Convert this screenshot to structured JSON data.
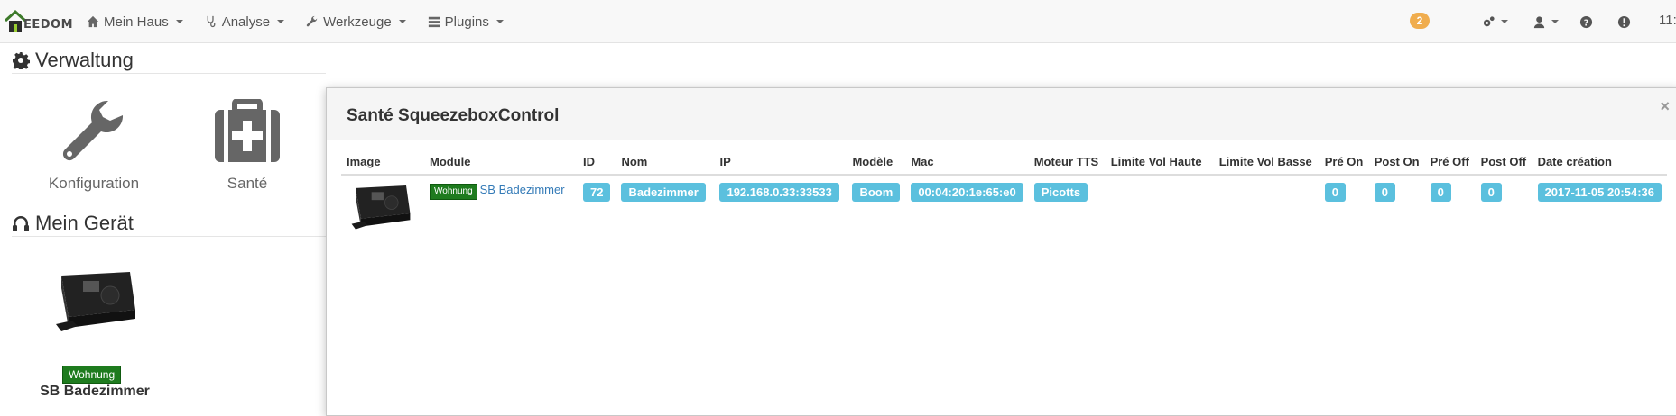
{
  "navbar": {
    "brand": "EEDOM",
    "menu": [
      {
        "label": "Mein Haus",
        "icon": "home-icon"
      },
      {
        "label": "Analyse",
        "icon": "stethoscope-icon"
      },
      {
        "label": "Werkzeuge",
        "icon": "wrench-icon"
      },
      {
        "label": "Plugins",
        "icon": "tasks-icon"
      }
    ],
    "notification_count": "2",
    "clock": "11:"
  },
  "left": {
    "verwaltung_title": "Verwaltung",
    "tiles": [
      {
        "label": "Konfiguration",
        "icon": "wrench-icon"
      },
      {
        "label": "Santé",
        "icon": "medkit-icon"
      }
    ],
    "geraet_title": "Mein Gerät",
    "device": {
      "room_badge": "Wohnung",
      "name": "SB Badezimmer"
    }
  },
  "modal": {
    "title": "Santé SqueezeboxControl",
    "close": "×",
    "columns": [
      "Image",
      "Module",
      "ID",
      "Nom",
      "IP",
      "Modèle",
      "Mac",
      "Moteur TTS",
      "Limite Vol Haute",
      "Limite Vol Basse",
      "Pré On",
      "Post On",
      "Pré Off",
      "Post Off",
      "Date création"
    ],
    "row": {
      "room_badge": "Wohnung",
      "module": "SB Badezimmer",
      "id": "72",
      "nom": "Badezimmer",
      "ip": "192.168.0.33:33533",
      "modele": "Boom",
      "mac": "00:04:20:1e:65:e0",
      "tts": "Picotts",
      "vol_haute": "",
      "vol_basse": "",
      "pre_on": "0",
      "post_on": "0",
      "pre_off": "0",
      "post_off": "0",
      "date": "2017-11-05 20:54:36"
    }
  },
  "colors": {
    "badge_info": "#5bc0de",
    "badge_room": "#1e7b1e",
    "badge_warning": "#f0ad4e",
    "link": "#337ab7"
  }
}
